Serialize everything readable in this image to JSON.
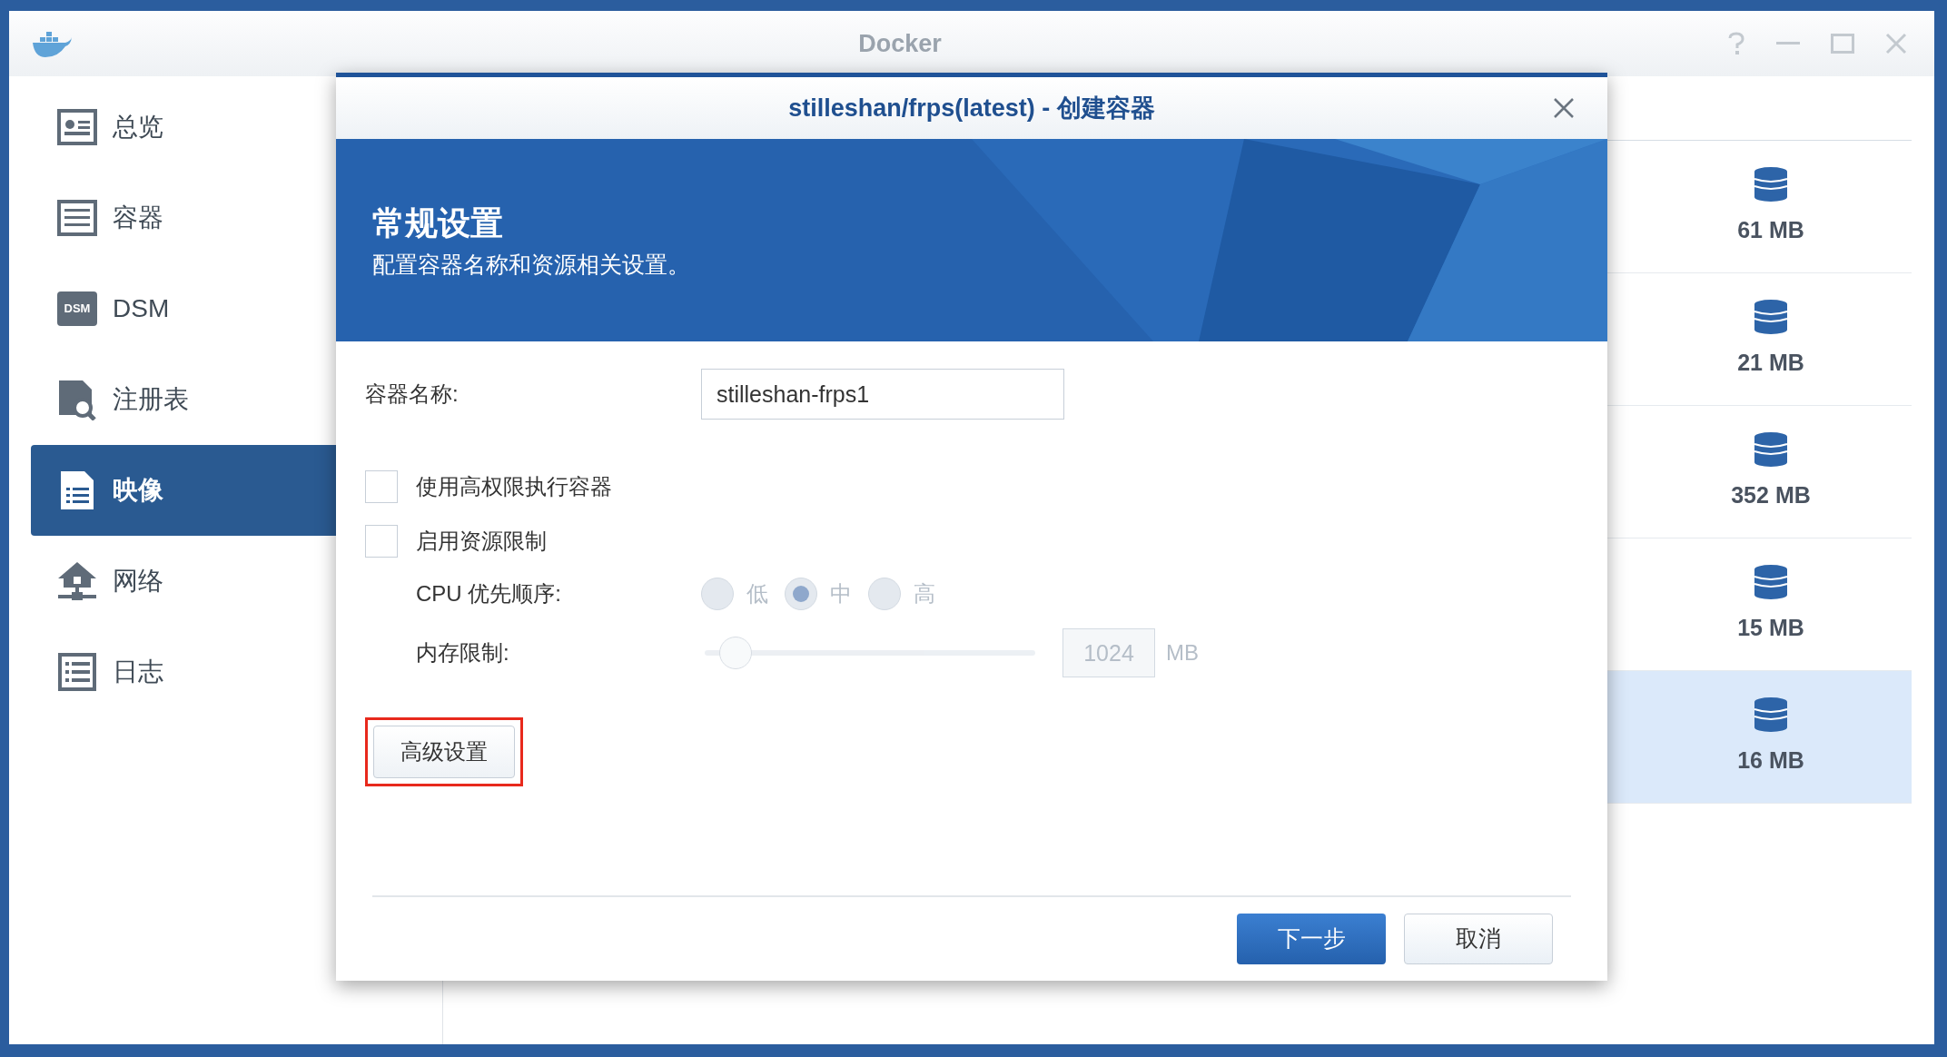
{
  "window": {
    "title": "Docker"
  },
  "sidebar": {
    "items": [
      {
        "label": "总览",
        "selected": false
      },
      {
        "label": "容器",
        "selected": false
      },
      {
        "label": "DSM",
        "icon_label": "DSM",
        "selected": false
      },
      {
        "label": "注册表",
        "selected": false
      },
      {
        "label": "映像",
        "selected": true
      },
      {
        "label": "网络",
        "selected": false
      },
      {
        "label": "日志",
        "selected": false
      }
    ]
  },
  "image_list": {
    "rows": [
      {
        "size": "61 MB",
        "selected": false
      },
      {
        "size": "21 MB",
        "selected": false
      },
      {
        "size": "352 MB",
        "selected": false
      },
      {
        "size": "15 MB",
        "selected": false
      },
      {
        "size": "16 MB",
        "selected": true
      }
    ]
  },
  "dialog": {
    "title": "stilleshan/frps(latest) - 创建容器",
    "banner": {
      "heading": "常规设置",
      "subtitle": "配置容器名称和资源相关设置。"
    },
    "name_field": {
      "label": "容器名称:",
      "value": "stilleshan-frps1"
    },
    "checkboxes": [
      {
        "label": "使用高权限执行容器",
        "checked": false
      },
      {
        "label": "启用资源限制",
        "checked": false
      }
    ],
    "cpu_priority": {
      "label": "CPU 优先顺序:",
      "disabled": true,
      "options": [
        {
          "label": "低",
          "selected": false
        },
        {
          "label": "中",
          "selected": true
        },
        {
          "label": "高",
          "selected": false
        }
      ]
    },
    "memory_limit": {
      "label": "内存限制:",
      "disabled": true,
      "level": 0.05,
      "value": "1024",
      "unit": "MB"
    },
    "advanced_button": {
      "label": "高级设置",
      "highlighted": true
    },
    "buttons": [
      {
        "label": "下一步",
        "kind": "primary"
      },
      {
        "label": "取消",
        "kind": "secondary"
      }
    ]
  }
}
